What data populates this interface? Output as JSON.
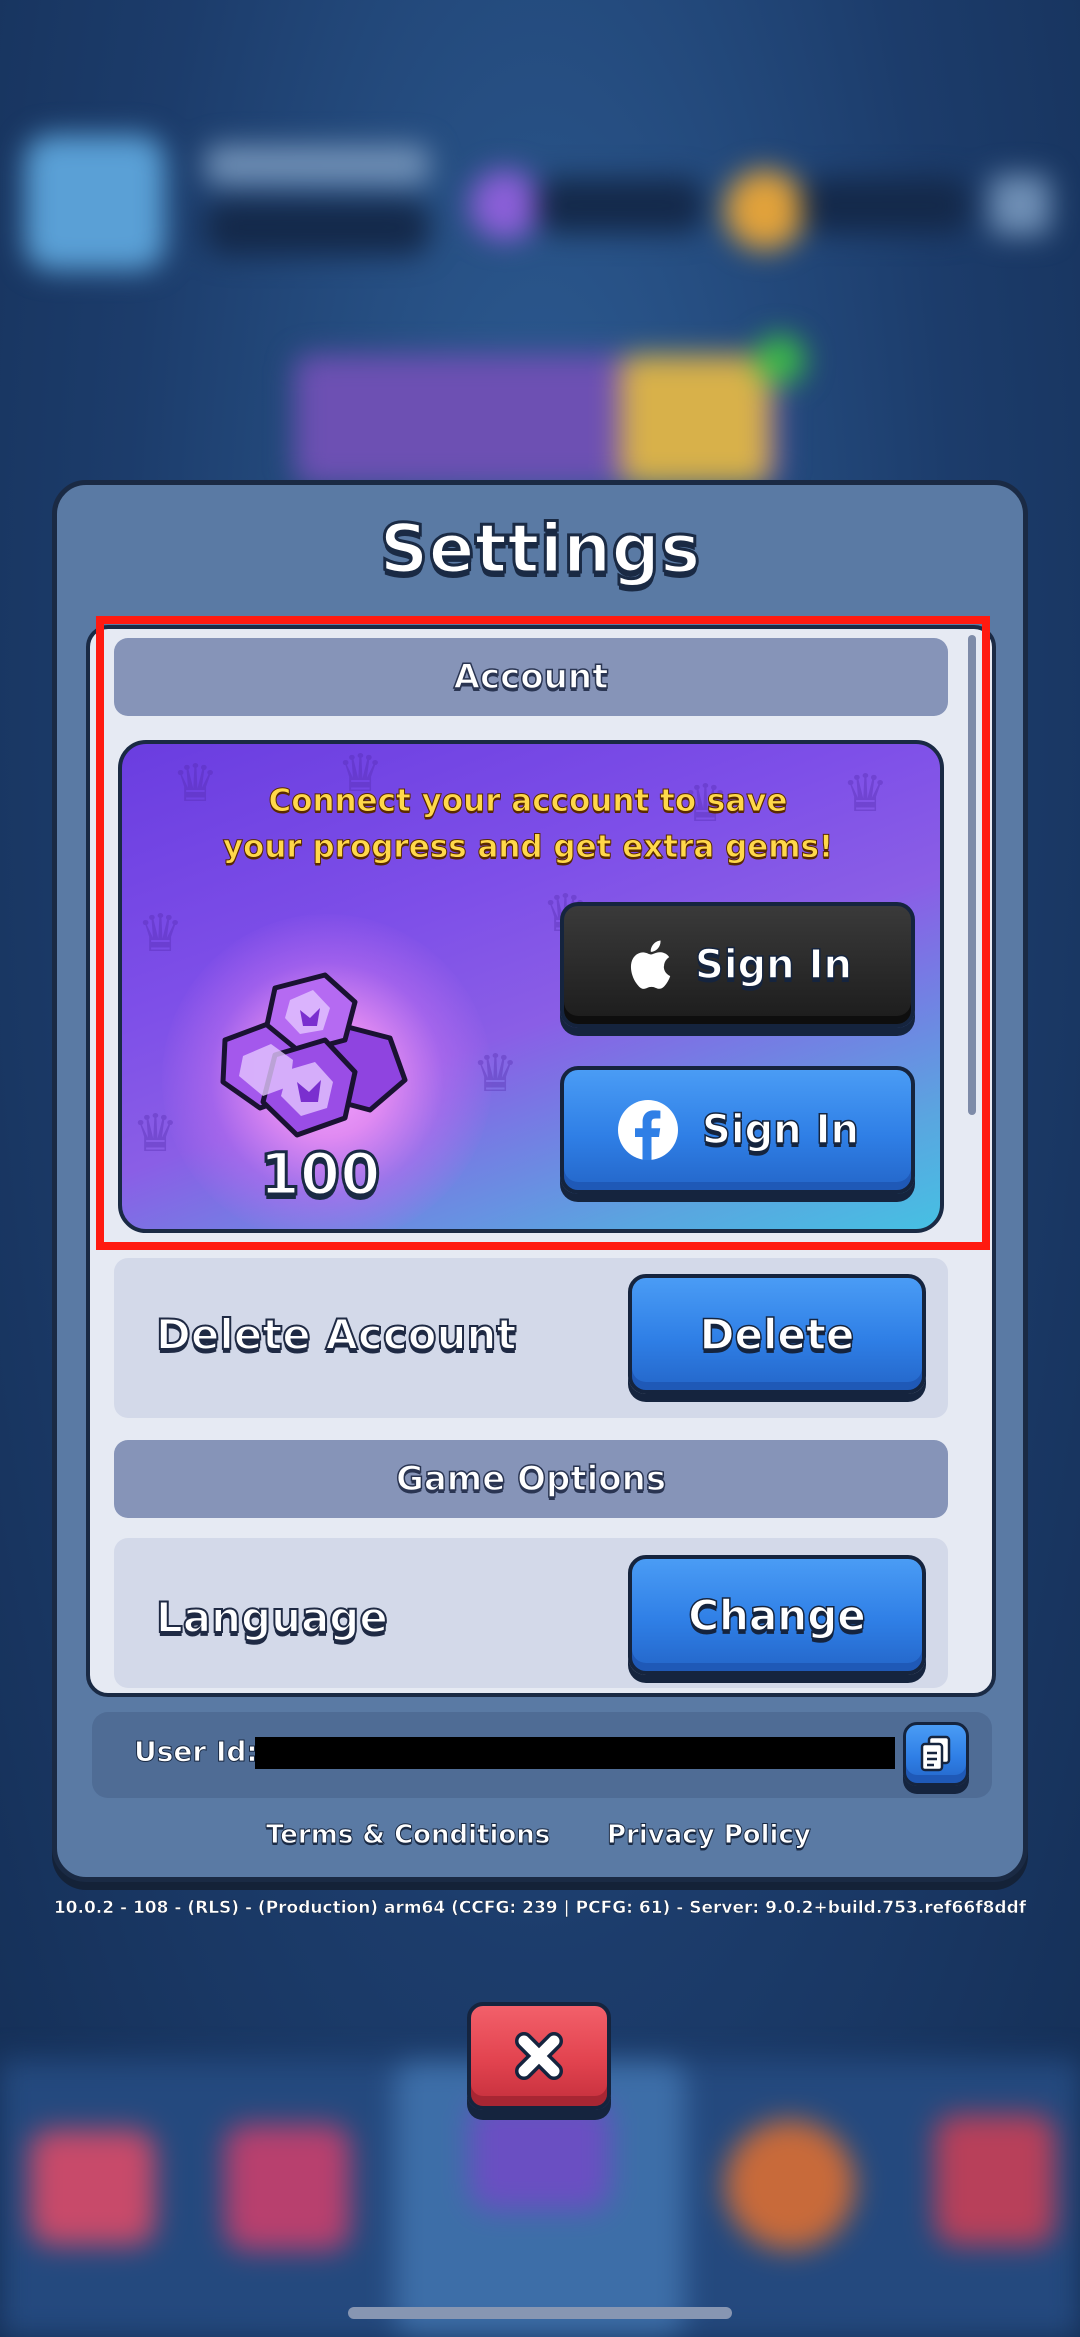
{
  "title": "Settings",
  "account": {
    "header": "Account",
    "promo_line1": "Connect your account to save",
    "promo_line2": "your progress and get extra gems!",
    "gem_reward": "100",
    "apple_signin_label": "Sign In",
    "facebook_signin_label": "Sign In"
  },
  "delete_account": {
    "label": "Delete Account",
    "button_label": "Delete"
  },
  "game_options": {
    "header": "Game Options",
    "language_label": "Language",
    "language_button_label": "Change"
  },
  "footer": {
    "user_id_label": "User Id:",
    "terms_label": "Terms & Conditions",
    "privacy_label": "Privacy Policy",
    "version": "10.0.2 - 108 - (RLS) - (Production)  arm64 (CCFG: 239 | PCFG: 61) - Server: 9.0.2+build.753.ref66f8ddf"
  },
  "colors": {
    "accent_blue": "#2f7fe6",
    "close_red": "#e2434f",
    "highlight_red": "#ff1a10",
    "promo_text": "#ffd84a"
  },
  "icons": [
    "apple-icon",
    "facebook-icon",
    "copy-icon",
    "close-icon",
    "gem-icon",
    "crown-icon"
  ]
}
